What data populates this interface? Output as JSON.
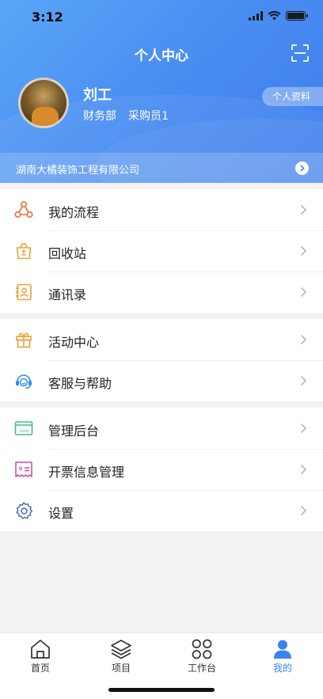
{
  "status": {
    "time": "3:12"
  },
  "header": {
    "title": "个人中心"
  },
  "user": {
    "name": "刘工",
    "department": "财务部",
    "role": "采购员1",
    "profile_button": "个人资料"
  },
  "company": {
    "name": "湖南大橘装饰工程有限公司"
  },
  "menu_groups": [
    {
      "items": [
        {
          "label": "我的流程",
          "icon": "process-icon"
        },
        {
          "label": "回收站",
          "icon": "recycle-bin-icon"
        },
        {
          "label": "通讯录",
          "icon": "contacts-icon"
        }
      ]
    },
    {
      "items": [
        {
          "label": "活动中心",
          "icon": "gift-icon"
        },
        {
          "label": "客服与帮助",
          "icon": "headset-icon"
        }
      ]
    },
    {
      "items": [
        {
          "label": "管理后台",
          "icon": "admin-icon"
        },
        {
          "label": "开票信息管理",
          "icon": "invoice-icon"
        },
        {
          "label": "设置",
          "icon": "gear-icon"
        }
      ]
    }
  ],
  "tabs": [
    {
      "label": "首页",
      "icon": "home-icon"
    },
    {
      "label": "项目",
      "icon": "layers-icon"
    },
    {
      "label": "工作台",
      "icon": "workbench-icon"
    },
    {
      "label": "我的",
      "icon": "user-icon",
      "active": true
    }
  ],
  "colors": {
    "accent": "#3b82f0",
    "header_start": "#5aa6f7",
    "header_end": "#3d7cec"
  }
}
